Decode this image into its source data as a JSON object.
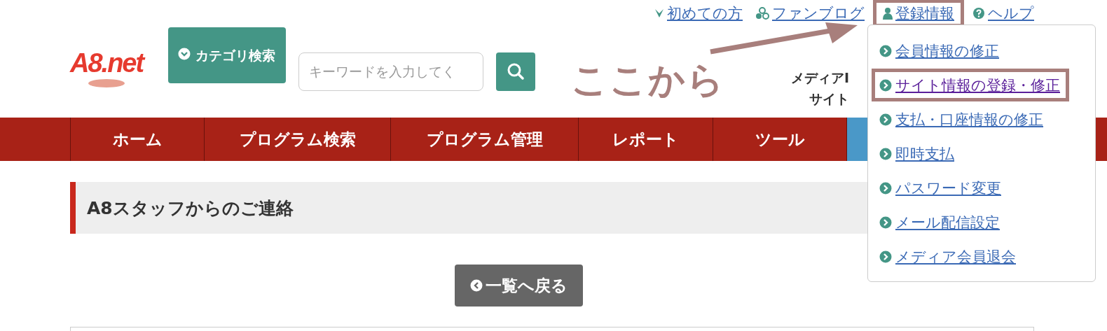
{
  "top_links": [
    {
      "label": "初めての方",
      "kind": "leaf",
      "annotated": false
    },
    {
      "label": "ファンブログ",
      "kind": "hexagons",
      "annotated": false
    },
    {
      "label": "登録情報",
      "kind": "person",
      "annotated": true
    },
    {
      "label": "ヘルプ",
      "kind": "question",
      "annotated": false
    }
  ],
  "header": {
    "logo": "A8.net",
    "category_button": "カテゴリ検索",
    "search": {
      "placeholder": "キーワードを入力してく"
    },
    "account_lines": [
      "メディアI",
      "サイト"
    ]
  },
  "nav": [
    {
      "label": "ホーム",
      "selected": false
    },
    {
      "label": "プログラム検索",
      "selected": false
    },
    {
      "label": "プログラム管理",
      "selected": false
    },
    {
      "label": "レポート",
      "selected": false
    },
    {
      "label": "ツール",
      "selected": false
    },
    {
      "selected": true
    }
  ],
  "notice": {
    "title": "A8スタッフからのご連絡",
    "back_button": "一覧へ戻る"
  },
  "dropdown": [
    {
      "label": "会員情報の修正",
      "visited": false,
      "annotated": false
    },
    {
      "label": "サイト情報の登録・修正",
      "visited": true,
      "annotated": true
    },
    {
      "label": "支払・口座情報の修正",
      "visited": false,
      "annotated": false
    },
    {
      "label": "即時支払",
      "visited": false,
      "annotated": false
    },
    {
      "label": "パスワード変更",
      "visited": false,
      "annotated": false
    },
    {
      "label": "メール配信設定",
      "visited": false,
      "annotated": false
    },
    {
      "label": "メディア会員退会",
      "visited": false,
      "annotated": false
    }
  ],
  "callout": {
    "text": "ここから"
  }
}
